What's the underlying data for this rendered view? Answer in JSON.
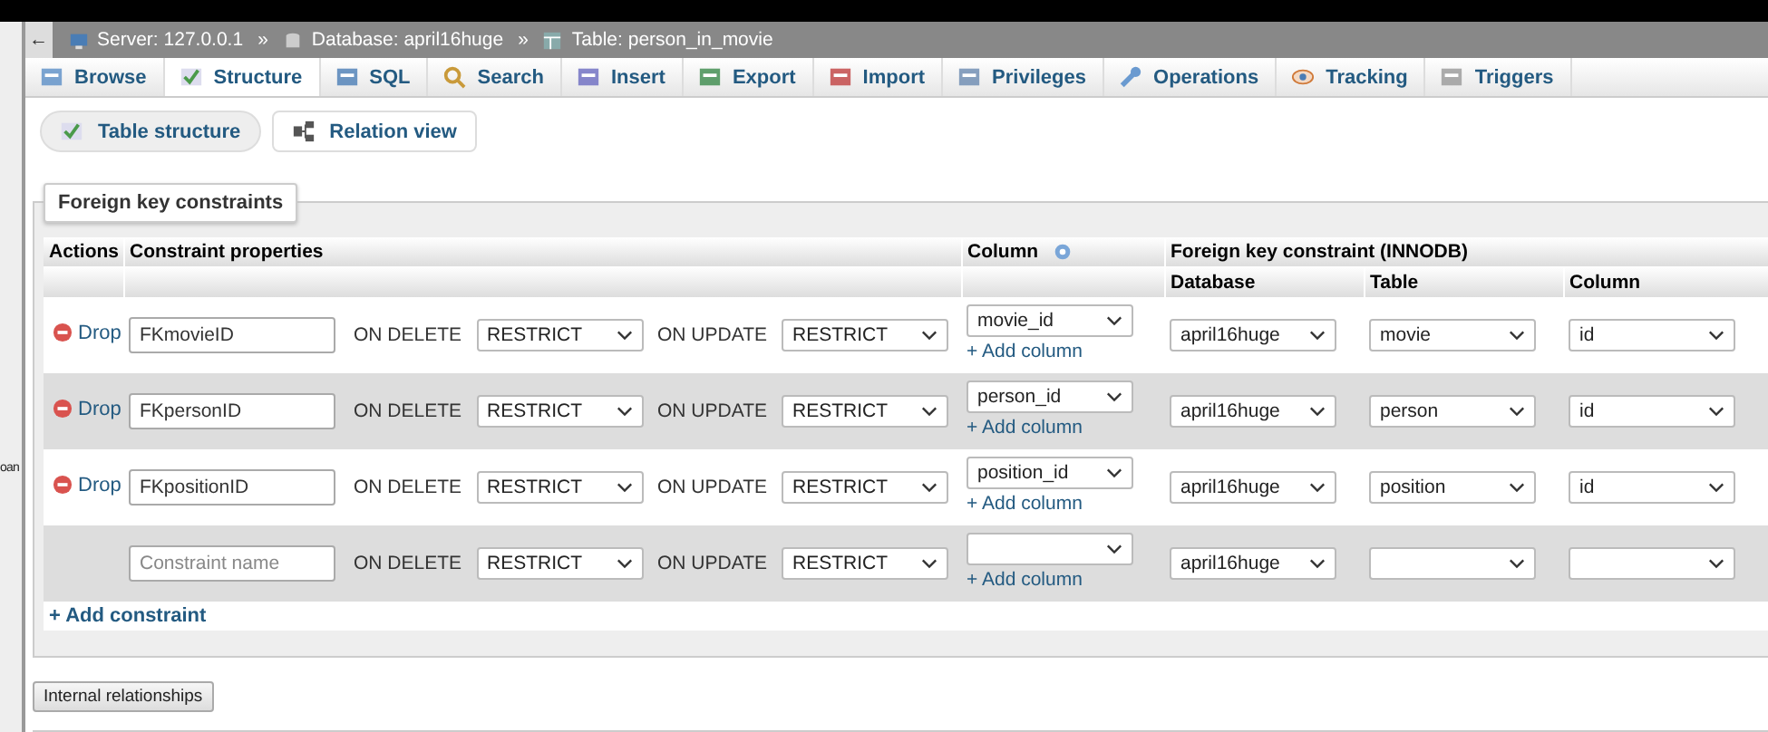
{
  "sidebar": {
    "fragment": "oan"
  },
  "breadcrumb": {
    "back": "←",
    "items": [
      {
        "kind": "server",
        "label": "Server: 127.0.0.1"
      },
      {
        "kind": "database",
        "label": "Database: april16huge"
      },
      {
        "kind": "table",
        "label": "Table: person_in_movie"
      }
    ],
    "separator": "»"
  },
  "tabs": [
    {
      "kind": "browse",
      "label": "Browse",
      "selected": false
    },
    {
      "kind": "structure",
      "label": "Structure",
      "selected": true
    },
    {
      "kind": "sql",
      "label": "SQL",
      "selected": false
    },
    {
      "kind": "search",
      "label": "Search",
      "selected": false
    },
    {
      "kind": "insert",
      "label": "Insert",
      "selected": false
    },
    {
      "kind": "export",
      "label": "Export",
      "selected": false
    },
    {
      "kind": "import",
      "label": "Import",
      "selected": false
    },
    {
      "kind": "privileges",
      "label": "Privileges",
      "selected": false
    },
    {
      "kind": "operations",
      "label": "Operations",
      "selected": false
    },
    {
      "kind": "tracking",
      "label": "Tracking",
      "selected": false
    },
    {
      "kind": "triggers",
      "label": "Triggers",
      "selected": false
    }
  ],
  "subtabs": [
    {
      "kind": "structure",
      "label": "Table structure",
      "selected": true
    },
    {
      "kind": "relation",
      "label": "Relation view",
      "selected": false
    }
  ],
  "fieldset": {
    "legend": "Foreign key constraints",
    "headers": {
      "actions": "Actions",
      "properties": "Constraint properties",
      "column": "Column",
      "foreign": "Foreign key constraint (INNODB)",
      "database": "Database",
      "table": "Table",
      "ref_column": "Column"
    },
    "rows": [
      {
        "drop": "Drop",
        "name": "FKmovieID",
        "on_delete_label": "ON DELETE",
        "on_delete": "RESTRICT",
        "on_update_label": "ON UPDATE",
        "on_update": "RESTRICT",
        "column": "movie_id",
        "add_column": "+ Add column",
        "database": "april16huge",
        "table": "movie",
        "ref_column": "id"
      },
      {
        "drop": "Drop",
        "name": "FKpersonID",
        "on_delete_label": "ON DELETE",
        "on_delete": "RESTRICT",
        "on_update_label": "ON UPDATE",
        "on_update": "RESTRICT",
        "column": "person_id",
        "add_column": "+ Add column",
        "database": "april16huge",
        "table": "person",
        "ref_column": "id"
      },
      {
        "drop": "Drop",
        "name": "FKpositionID",
        "on_delete_label": "ON DELETE",
        "on_delete": "RESTRICT",
        "on_update_label": "ON UPDATE",
        "on_update": "RESTRICT",
        "column": "position_id",
        "add_column": "+ Add column",
        "database": "april16huge",
        "table": "position",
        "ref_column": "id"
      },
      {
        "placeholder": "Constraint name",
        "on_delete_label": "ON DELETE",
        "on_delete": "RESTRICT",
        "on_update_label": "ON UPDATE",
        "on_update": "RESTRICT",
        "add_column": "+ Add column",
        "database": "april16huge"
      }
    ],
    "add_constraint": "+ Add constraint"
  },
  "internal_button": "Internal relationships"
}
